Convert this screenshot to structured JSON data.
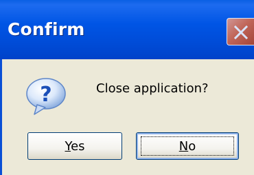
{
  "window": {
    "title": "Confirm",
    "close_icon": "close-icon"
  },
  "dialog": {
    "icon": "question-icon",
    "message": "Close application?"
  },
  "buttons": {
    "yes_label": "Yes",
    "no_label": "No",
    "default_button": "No"
  },
  "colors": {
    "titlebar": "#0055E5",
    "background": "#ECE9D8",
    "close_button": "#E36B43"
  }
}
